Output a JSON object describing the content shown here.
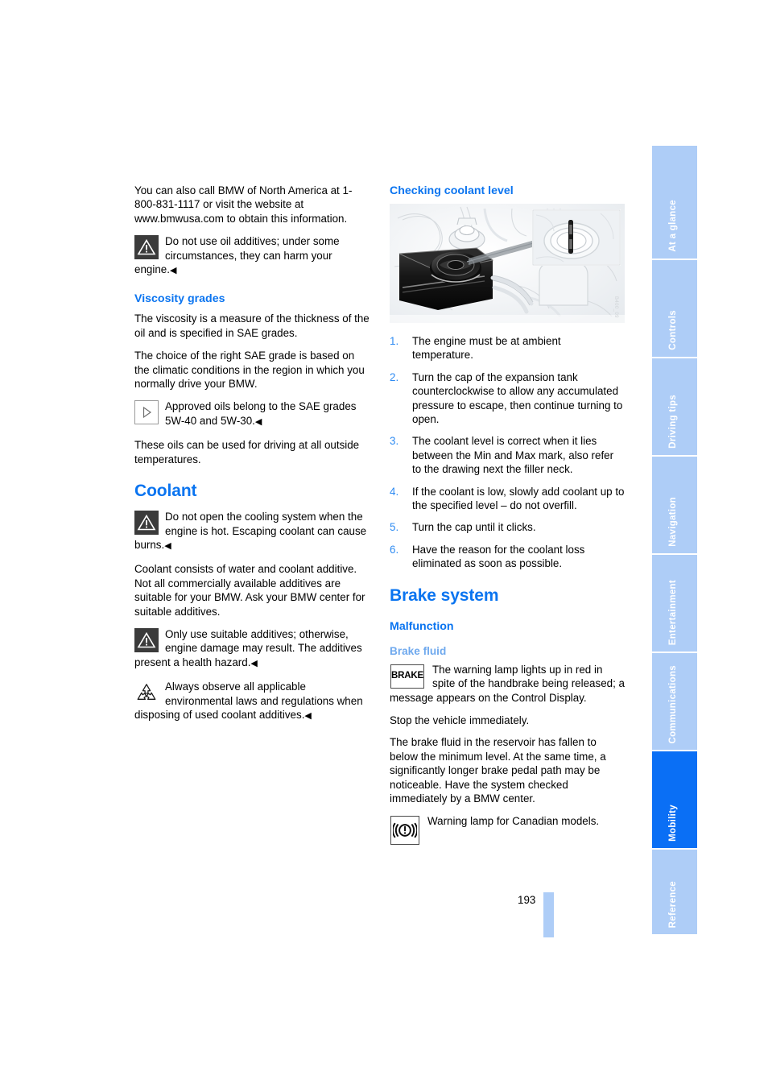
{
  "document": {
    "page_number": "193",
    "figure_code": "B400_09"
  },
  "left_column": {
    "intro": "You can also call BMW of North America at 1-800-831-1117 or visit the website at www.bmwusa.com to obtain this information.",
    "warning_oil_additives": "Do not use oil additives; under some circumstances, they can harm your engine.",
    "viscosity_heading": "Viscosity grades",
    "viscosity_p1": "The viscosity is a measure of the thickness of the oil and is specified in SAE grades.",
    "viscosity_p2": "The choice of the right SAE grade is based on the climatic conditions in the region in which you normally drive your BMW.",
    "approved_oils_note": "Approved oils belong to the SAE grades 5W-40 and 5W-30.",
    "viscosity_p3": "These oils can be used for driving at all outside temperatures.",
    "coolant_heading": "Coolant",
    "warning_cooling_system": "Do not open the cooling system when the engine is hot. Escaping coolant can cause burns.",
    "coolant_p1": "Coolant consists of water and coolant additive. Not all commercially available additives are suitable for your BMW. Ask your BMW center for suitable additives.",
    "warning_additives": "Only use suitable additives; otherwise, engine damage may result. The additives present a health hazard.",
    "recycle_note": "Always observe all applicable environmental laws and regulations when disposing of used coolant additives."
  },
  "right_column": {
    "checking_heading": "Checking coolant level",
    "steps": [
      {
        "num": "1.",
        "text": "The engine must be at ambient temperature."
      },
      {
        "num": "2.",
        "text": "Turn the cap of the expansion tank counterclockwise to allow any accumulated pressure to escape, then continue turning to open."
      },
      {
        "num": "3.",
        "text": "The coolant level is correct when it lies between the Min and Max mark, also refer to the drawing next the filler neck."
      },
      {
        "num": "4.",
        "text": "If the coolant is low, slowly add coolant up to the specified level – do not overfill."
      },
      {
        "num": "5.",
        "text": "Turn the cap until it clicks."
      },
      {
        "num": "6.",
        "text": "Have the reason for the coolant loss eliminated as soon as possible."
      }
    ],
    "brake_heading": "Brake system",
    "malfunction_heading": "Malfunction",
    "brake_fluid_heading": "Brake fluid",
    "brake_lamp_label": "BRAKE",
    "brake_lamp_note": "The warning lamp lights up in red in spite of the handbrake being released; a message appears on the Control Display.",
    "brake_p_stop": "Stop the vehicle immediately.",
    "brake_p_detail": "The brake fluid in the reservoir has fallen to below the minimum level. At the same time, a significantly longer brake pedal path may be noticeable. Have the system checked immediately by a BMW center.",
    "canadian_lamp_note": "Warning lamp for Canadian models."
  },
  "tabs": [
    {
      "label": "At a glance",
      "active": false
    },
    {
      "label": "Controls",
      "active": false
    },
    {
      "label": "Driving tips",
      "active": false
    },
    {
      "label": "Navigation",
      "active": false
    },
    {
      "label": "Entertainment",
      "active": false
    },
    {
      "label": "Communications",
      "active": false
    },
    {
      "label": "Mobility",
      "active": true
    },
    {
      "label": "Reference",
      "active": false
    }
  ],
  "colors": {
    "heading_blue": "#0a74f0",
    "sub_blue": "#6fa9ee",
    "tab_blue": "#aecdf7",
    "tab_active_blue": "#0a6ff5",
    "number_blue": "#2e8bf2"
  },
  "icons": {
    "warning": "warning-triangle-icon",
    "info_play": "play-triangle-icon",
    "recycle": "recycle-icon",
    "brake_lamp": "brake-warning-lamp-icon",
    "canadian_lamp": "canadian-brake-warning-lamp-icon"
  },
  "endmark": "◀"
}
